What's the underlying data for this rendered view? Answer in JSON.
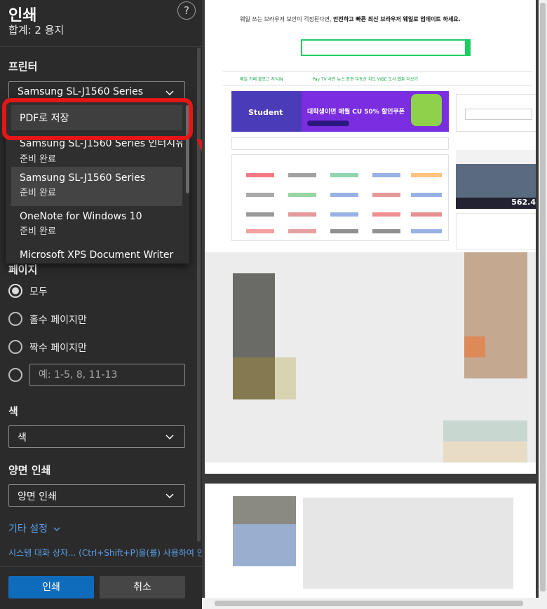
{
  "panel": {
    "title": "인쇄",
    "total": "합계: 2 용지",
    "help": "?",
    "printer_label": "프린터",
    "printer_selected": "Samsung SL-J1560 Series",
    "dropdown": {
      "first": "PDF로 저장",
      "items": [
        {
          "name": "Samsung SL-J1560 Series 인터시유",
          "status": "준비 완료"
        },
        {
          "name": "Samsung SL-J1560 Series",
          "status": "준비 완료"
        },
        {
          "name": "OneNote for Windows 10",
          "status": "준비 완료"
        },
        {
          "name": "Microsoft XPS Document Writer",
          "status": ""
        }
      ]
    },
    "pages_label": "페이지",
    "pages_options": [
      {
        "label": "모두",
        "checked": true
      },
      {
        "label": "홀수 페이지만",
        "checked": false
      },
      {
        "label": "짝수 페이지만",
        "checked": false
      }
    ],
    "range_placeholder": "예: 1-5, 8, 11-13",
    "color_label": "색",
    "color_value": "색",
    "duplex_label": "양면 인쇄",
    "duplex_value": "양면 인쇄",
    "more_settings": "기타 설정",
    "system_dialog": "시스템 대화 상자... (Ctrl+Shift+P)을(를) 사용하여 인",
    "print_button": "인쇄",
    "cancel_button": "취소"
  },
  "preview": {
    "banner_text_plain": "웨일 쓰는 브라우저 보안이 걱정된다면, ",
    "banner_text_bold": "안전하고 빠른 최신 브라우저 웨일로 업데이트 하세요.",
    "nav": "메일   카페   블로그   지식iN",
    "nav_right": "Pay   TV   사전   뉴스   증권   부동산   지도   VIBE   도서   웹툰   더보기",
    "ad_left": "Student",
    "ad_text": "대학생이면 매월 CU 50% 할인쿠폰",
    "side_ad_price": "562.4"
  },
  "colors": {
    "panel_bg": "#2b2b2b",
    "accent": "#0f6cbd",
    "highlight": "#e51616",
    "link": "#5aa0e8"
  }
}
